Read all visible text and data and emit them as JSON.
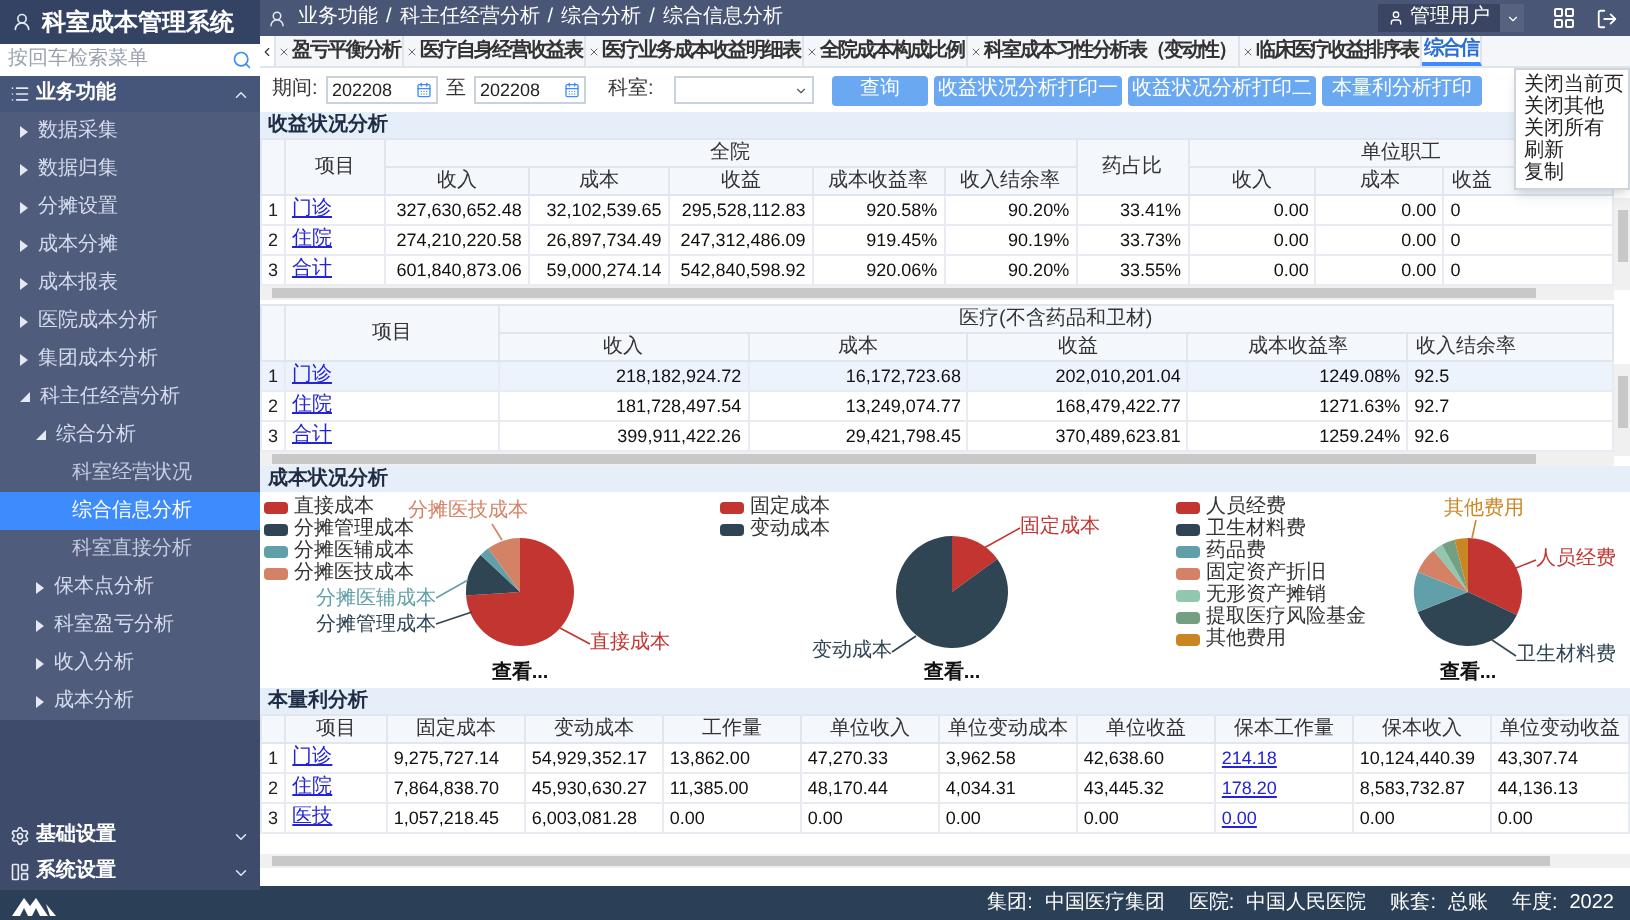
{
  "app": {
    "title": "科室成本管理系统"
  },
  "sidebar": {
    "search": {
      "placeholder": "按回车检索菜单"
    },
    "sections": [
      {
        "label": "业务功能",
        "expanded": true,
        "children": [
          {
            "label": "数据采集",
            "expanded": false
          },
          {
            "label": "数据归集",
            "expanded": false
          },
          {
            "label": "分摊设置",
            "expanded": false
          },
          {
            "label": "成本分摊",
            "expanded": false
          },
          {
            "label": "成本报表",
            "expanded": false
          },
          {
            "label": "医院成本分析",
            "expanded": false
          },
          {
            "label": "集团成本分析",
            "expanded": false
          },
          {
            "label": "科主任经营分析",
            "expanded": true,
            "children": [
              {
                "label": "综合分析",
                "expanded": true,
                "children": [
                  {
                    "label": "科室经营状况",
                    "selected": false
                  },
                  {
                    "label": "综合信息分析",
                    "selected": true
                  },
                  {
                    "label": "科室直接分析",
                    "selected": false
                  }
                ]
              },
              {
                "label": "保本点分析",
                "expanded": false
              },
              {
                "label": "科室盈亏分析",
                "expanded": false
              },
              {
                "label": "收入分析",
                "expanded": false
              },
              {
                "label": "成本分析",
                "expanded": false
              }
            ]
          }
        ]
      },
      {
        "label": "基础设置",
        "expanded": false
      },
      {
        "label": "系统设置",
        "expanded": false
      }
    ]
  },
  "breadcrumb": {
    "separator": "/",
    "items": [
      "业务功能",
      "科主任经营分析",
      "综合分析",
      "综合信息分析"
    ]
  },
  "user": {
    "name": "管理用户"
  },
  "tabs": [
    {
      "label": "盈亏平衡分析",
      "selected": false,
      "closable": true
    },
    {
      "label": "医疗自身经营收益表",
      "selected": false,
      "closable": true
    },
    {
      "label": "医疗业务成本收益明细表",
      "selected": false,
      "closable": true
    },
    {
      "label": "全院成本构成比例",
      "selected": false,
      "closable": true
    },
    {
      "label": "科室成本习性分析表（变动性）",
      "selected": false,
      "closable": true
    },
    {
      "label": "临床医疗收益排序表",
      "selected": false,
      "closable": true
    },
    {
      "label": "综合信",
      "selected": true,
      "closable": false
    }
  ],
  "context_menu": {
    "items": [
      "关闭当前页",
      "关闭其他",
      "关闭所有",
      "刷新",
      "复制"
    ]
  },
  "filters": {
    "period_label": "期间:",
    "from": "202208",
    "to_label": "至",
    "to": "202208",
    "dept_label": "科室:"
  },
  "buttons": [
    "查询",
    "收益状况分析打印一",
    "收益状况分析打印二",
    "本量利分析打印"
  ],
  "income_section": {
    "title": "收益状况分析",
    "table1": {
      "row_header": "项目",
      "groups": [
        {
          "label": "全院",
          "columns": [
            "收入",
            "成本",
            "收益",
            "成本收益率",
            "收入结余率"
          ]
        },
        {
          "label": "药占比"
        },
        {
          "label": "单位职工",
          "columns": [
            "收入",
            "成本",
            "收益"
          ]
        }
      ],
      "rows": [
        {
          "index": "1",
          "item": "门诊",
          "values": [
            "327,630,652.48",
            "32,102,539.65",
            "295,528,112.83",
            "920.58%",
            "90.20%",
            "33.41%",
            "0.00",
            "0.00",
            "0"
          ]
        },
        {
          "index": "2",
          "item": "住院",
          "values": [
            "274,210,220.58",
            "26,897,734.49",
            "247,312,486.09",
            "919.45%",
            "90.19%",
            "33.73%",
            "0.00",
            "0.00",
            "0"
          ]
        },
        {
          "index": "3",
          "item": "合计",
          "values": [
            "601,840,873.06",
            "59,000,274.14",
            "542,840,598.92",
            "920.06%",
            "90.20%",
            "33.55%",
            "0.00",
            "0.00",
            "0"
          ]
        }
      ]
    },
    "table2": {
      "row_header": "项目",
      "groups": [
        {
          "label": "医疗(不含药品和卫材)",
          "columns": [
            "收入",
            "成本",
            "收益",
            "成本收益率",
            "收入结余率"
          ]
        }
      ],
      "rows": [
        {
          "index": "1",
          "item": "门诊",
          "selected": true,
          "values": [
            "218,182,924.72",
            "16,172,723.68",
            "202,010,201.04",
            "1249.08%",
            "92.5"
          ]
        },
        {
          "index": "2",
          "item": "住院",
          "selected": false,
          "values": [
            "181,728,497.54",
            "13,249,074.77",
            "168,479,422.77",
            "1271.63%",
            "92.7"
          ]
        },
        {
          "index": "3",
          "item": "合计",
          "selected": false,
          "values": [
            "399,911,422.26",
            "29,421,798.45",
            "370,489,623.81",
            "1259.24%",
            "92.6"
          ]
        }
      ]
    }
  },
  "cost_section": {
    "title": "成本状况分析",
    "charts": [
      {
        "legend": [
          {
            "label": "直接成本",
            "color": "#c23531"
          },
          {
            "label": "分摊管理成本",
            "color": "#2f4554"
          },
          {
            "label": "分摊医辅成本",
            "color": "#61a0a8"
          },
          {
            "label": "分摊医技成本",
            "color": "#d48265"
          }
        ],
        "callouts": [
          {
            "label": "分摊医技成本",
            "color": "#d48265"
          },
          {
            "label": "分摊医辅成本",
            "color": "#61a0a8"
          },
          {
            "label": "分摊管理成本",
            "color": "#2f4554"
          },
          {
            "label": "直接成本",
            "color": "#c23531"
          }
        ],
        "link": "查看..."
      },
      {
        "legend": [
          {
            "label": "固定成本",
            "color": "#c23531"
          },
          {
            "label": "变动成本",
            "color": "#2f4554"
          }
        ],
        "callouts": [
          {
            "label": "固定成本",
            "color": "#c23531"
          },
          {
            "label": "变动成本",
            "color": "#2f4554"
          }
        ],
        "link": "查看..."
      },
      {
        "legend": [
          {
            "label": "人员经费",
            "color": "#c23531"
          },
          {
            "label": "卫生材料费",
            "color": "#2f4554"
          },
          {
            "label": "药品费",
            "color": "#61a0a8"
          },
          {
            "label": "固定资产折旧",
            "color": "#d48265"
          },
          {
            "label": "无形资产摊销",
            "color": "#91c7ae"
          },
          {
            "label": "提取医疗风险基金",
            "color": "#749f83"
          },
          {
            "label": "其他费用",
            "color": "#ca8622"
          }
        ],
        "callouts": [
          {
            "label": "其他费用",
            "color": "#ca8622"
          },
          {
            "label": "人员经费",
            "color": "#c23531"
          },
          {
            "label": "卫生材料费",
            "color": "#2f4554"
          }
        ],
        "link": "查看..."
      }
    ]
  },
  "cvp_section": {
    "title": "本量利分析",
    "table": {
      "row_header": "项目",
      "groups": [
        {
          "label": "固定成本",
          "kind": "number"
        },
        {
          "label": "变动成本",
          "kind": "number"
        },
        {
          "label": "工作量",
          "kind": "number"
        },
        {
          "label": "单位收入",
          "kind": "number"
        },
        {
          "label": "单位变动成本",
          "kind": "number"
        },
        {
          "label": "单位收益",
          "kind": "number"
        },
        {
          "label": "保本工作量",
          "kind": "link"
        },
        {
          "label": "保本收入",
          "kind": "number"
        },
        {
          "label": "单位变动收益",
          "kind": "number"
        }
      ],
      "rows": [
        {
          "index": "1",
          "item": "门诊",
          "values": [
            "9,275,727.14",
            "54,929,352.17",
            "13,862.00",
            "47,270.33",
            "3,962.58",
            "42,638.60",
            "214.18",
            "10,124,440.39",
            "43,307.74"
          ]
        },
        {
          "index": "2",
          "item": "住院",
          "values": [
            "7,864,838.70",
            "45,930,630.27",
            "11,385.00",
            "48,170.44",
            "4,034.31",
            "43,445.32",
            "178.20",
            "8,583,732.87",
            "44,136.13"
          ]
        },
        {
          "index": "3",
          "item": "医技",
          "values": [
            "1,057,218.45",
            "6,003,081.28",
            "0.00",
            "0.00",
            "0.00",
            "0.00",
            "0.00",
            "0.00",
            "0.00"
          ]
        }
      ]
    }
  },
  "status_bar": [
    {
      "label": "集团:",
      "value": "中国医疗集团"
    },
    {
      "label": "医院:",
      "value": "中国人民医院"
    },
    {
      "label": "账套:",
      "value": "总账"
    },
    {
      "label": "年度:",
      "value": "2022"
    }
  ]
}
